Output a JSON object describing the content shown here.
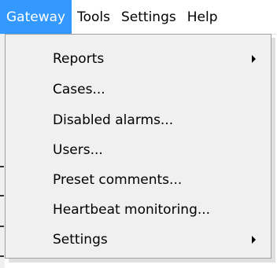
{
  "menubar": {
    "items": [
      {
        "label": "Gateway",
        "active": true
      },
      {
        "label": "Tools",
        "active": false
      },
      {
        "label": "Settings",
        "active": false
      },
      {
        "label": "Help",
        "active": false
      }
    ]
  },
  "dropdown": {
    "parent": "Gateway",
    "items": [
      {
        "label": "Reports",
        "has_submenu": true
      },
      {
        "label": "Cases...",
        "has_submenu": false
      },
      {
        "label": "Disabled alarms...",
        "has_submenu": false
      },
      {
        "label": "Users...",
        "has_submenu": false
      },
      {
        "label": "Preset comments...",
        "has_submenu": false
      },
      {
        "label": "Heartbeat monitoring...",
        "has_submenu": false
      },
      {
        "label": "Settings",
        "has_submenu": true
      }
    ]
  },
  "colors": {
    "highlight": "#3399ff",
    "menu_background": "#f0f0f0",
    "menu_border": "#a0a0a0"
  },
  "icons": [
    "chevron-right-icon"
  ]
}
